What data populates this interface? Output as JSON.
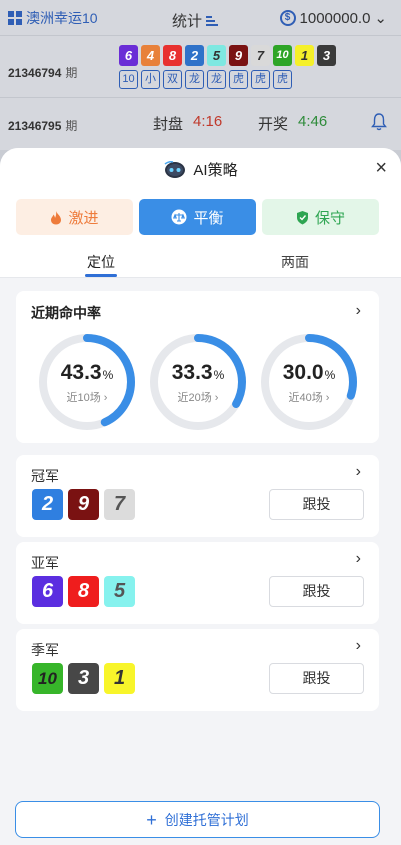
{
  "topbar": {
    "game_name": "澳洲幸运10",
    "stats_label": "统计",
    "balance": "1000000.0"
  },
  "latest_issue": {
    "number": "21346794",
    "suffix": "期",
    "balls": [
      {
        "n": "6",
        "bg": "#6a2dd6",
        "fg": "#ffffff"
      },
      {
        "n": "4",
        "bg": "#e8813a",
        "fg": "#ffffff"
      },
      {
        "n": "8",
        "bg": "#e8312f",
        "fg": "#ffffff"
      },
      {
        "n": "2",
        "bg": "#2f72c9",
        "fg": "#ffffff"
      },
      {
        "n": "5",
        "bg": "#7ee8e1",
        "fg": "#333333"
      },
      {
        "n": "9",
        "bg": "#7a1212",
        "fg": "#ffffff"
      },
      {
        "n": "7",
        "bg": "#d9d9d9",
        "fg": "#333333"
      },
      {
        "n": "10",
        "bg": "#2ea527",
        "fg": "#ffffff"
      },
      {
        "n": "1",
        "bg": "#f5f02a",
        "fg": "#333333"
      },
      {
        "n": "3",
        "bg": "#3a3a3a",
        "fg": "#ffffff"
      }
    ],
    "tags": [
      "10",
      "小",
      "双",
      "龙",
      "龙",
      "虎",
      "虎",
      "虎"
    ]
  },
  "current_issue": {
    "number": "21346795",
    "suffix": "期",
    "close_label": "封盘",
    "close_time": "4:16",
    "draw_label": "开奖",
    "draw_time": "4:46"
  },
  "sheet": {
    "title": "AI策略",
    "strategies": [
      {
        "label": "激进",
        "icon": "flame-icon"
      },
      {
        "label": "平衡",
        "icon": "scale-icon"
      },
      {
        "label": "保守",
        "icon": "shield-icon"
      }
    ],
    "selected_strategy": "平衡",
    "tabs": [
      "定位",
      "两面"
    ],
    "active_tab": "定位",
    "hit_rate": {
      "title": "近期命中率",
      "rings": [
        {
          "value": "43.3",
          "unit": "%",
          "caption": "近10场",
          "fraction": 0.433
        },
        {
          "value": "33.3",
          "unit": "%",
          "caption": "近20场",
          "fraction": 0.333
        },
        {
          "value": "30.0",
          "unit": "%",
          "caption": "近40场",
          "fraction": 0.3
        }
      ]
    },
    "positions": [
      {
        "label": "冠军",
        "follow": "跟投",
        "balls": [
          {
            "n": "2",
            "bg": "#2f7fe0",
            "fg": "#ffffff"
          },
          {
            "n": "9",
            "bg": "#7a1212",
            "fg": "#ffffff"
          },
          {
            "n": "7",
            "bg": "#dcdcdc",
            "fg": "#555555"
          }
        ]
      },
      {
        "label": "亚军",
        "follow": "跟投",
        "balls": [
          {
            "n": "6",
            "bg": "#5b2ee0",
            "fg": "#ffffff"
          },
          {
            "n": "8",
            "bg": "#ef1d1d",
            "fg": "#ffffff"
          },
          {
            "n": "5",
            "bg": "#86f2ee",
            "fg": "#555555"
          }
        ]
      },
      {
        "label": "季军",
        "follow": "跟投",
        "balls": [
          {
            "n": "10",
            "bg": "#37b52a",
            "fg": "#222222"
          },
          {
            "n": "3",
            "bg": "#474747",
            "fg": "#ffffff"
          },
          {
            "n": "1",
            "bg": "#f8f52a",
            "fg": "#333333"
          }
        ]
      }
    ],
    "create_button": "创建托管计划"
  },
  "colors": {
    "accent": "#3a8ee6",
    "ring_track": "#e6e8ec"
  }
}
